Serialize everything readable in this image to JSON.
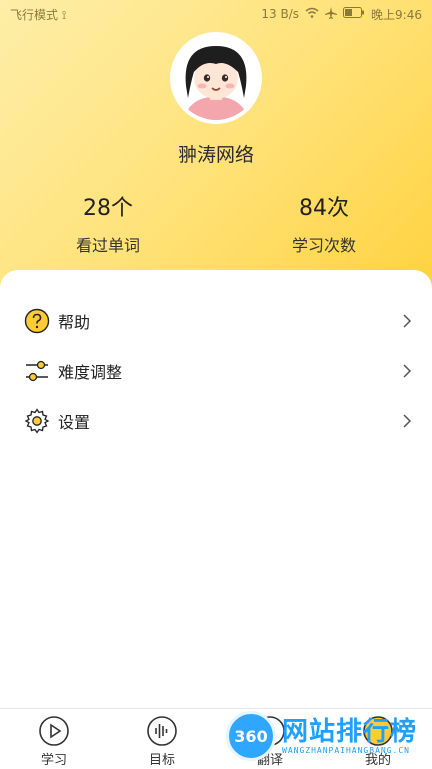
{
  "status_bar": {
    "left": "飞行模式 ⟟",
    "speed": "13 B/s",
    "time": "晚上9:46"
  },
  "profile": {
    "username": "翀涛网络",
    "stats": [
      {
        "value": "28个",
        "label": "看过单词"
      },
      {
        "value": "84次",
        "label": "学习次数"
      }
    ]
  },
  "menu": {
    "items": [
      {
        "label": "帮助",
        "icon": "help-icon"
      },
      {
        "label": "难度调整",
        "icon": "sliders-icon"
      },
      {
        "label": "设置",
        "icon": "gear-icon"
      }
    ]
  },
  "tabs": [
    {
      "label": "学习",
      "icon": "play-icon"
    },
    {
      "label": "目标",
      "icon": "soundwave-icon"
    },
    {
      "label": "翻译",
      "icon": "translate-icon"
    },
    {
      "label": "我的",
      "icon": "user-icon"
    }
  ],
  "watermark": {
    "badge": "360",
    "main": "网站排行榜",
    "sub": "WANGZHANPAIHANGBANG.CN"
  },
  "colors": {
    "header_gradient_start": "#fdeea8",
    "header_gradient_end": "#ffd23e",
    "help_icon_fill": "#ffcc33"
  }
}
